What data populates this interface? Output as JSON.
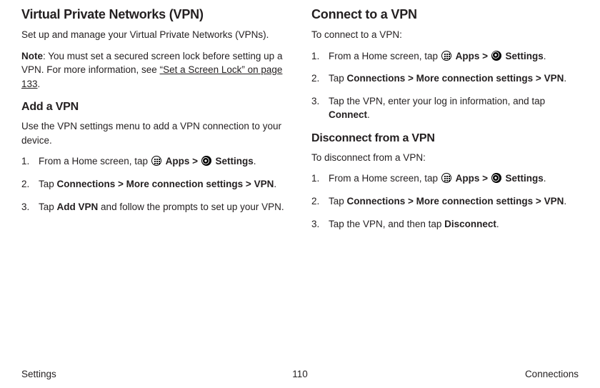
{
  "footer": {
    "left": "Settings",
    "center": "110",
    "right": "Connections"
  },
  "left": {
    "h_vpn": "Virtual Private Networks (VPN)",
    "intro": "Set up and manage your Virtual Private Networks (VPNs).",
    "note_label": "Note",
    "note_body1": ": You must set a secured screen lock before setting up a VPN. For more information, see ",
    "note_xref": "“Set a Screen Lock” on page 133",
    "note_body2": ".",
    "h_add": "Add a VPN",
    "add_intro": "Use the VPN settings menu to add a VPN connection to your device.",
    "steps_common_1a": "From a Home screen, tap ",
    "apps": "Apps",
    "gt": " > ",
    "settings": "Settings",
    "period": ".",
    "step2_a": "Tap ",
    "step2_path": "Connections > More connection settings > VPN",
    "add_step3_a": "Tap ",
    "add_step3_b": "Add VPN",
    "add_step3_c": " and follow the prompts to set up your VPN."
  },
  "right": {
    "h_connect": "Connect to a VPN",
    "connect_intro": "To connect to a VPN:",
    "connect_step3_a": "Tap the VPN, enter your log in information, and tap ",
    "connect_step3_b": "Connect",
    "h_disconnect": "Disconnect from a VPN",
    "disconnect_intro": "To disconnect from a VPN:",
    "disconnect_step3_a": "Tap the VPN, and then tap ",
    "disconnect_step3_b": "Disconnect"
  }
}
